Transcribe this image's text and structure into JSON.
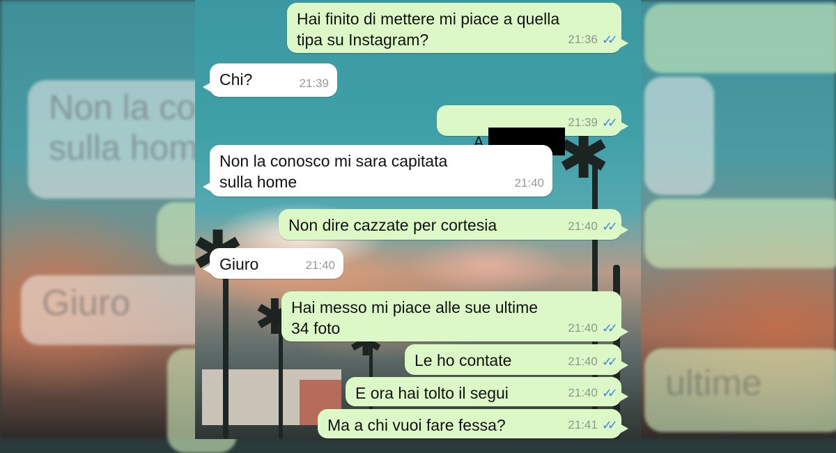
{
  "colors": {
    "outgoing_bubble": "#dcf8c6",
    "incoming_bubble": "#ffffff",
    "read_ticks": "#3d8be0"
  },
  "background_ghost_text": {
    "left_1": "Non la co",
    "left_2": "sulla hom",
    "left_3": "Giuro",
    "right_1": "ultime"
  },
  "messages": [
    {
      "direction": "out",
      "line1": "Hai finito di mettere mi piace a quella",
      "line2": "tipa su Instagram?",
      "time": "21:36",
      "ticks": "✓✓"
    },
    {
      "direction": "in",
      "line1": "Chi?",
      "time": "21:39"
    },
    {
      "direction": "out",
      "line1": "A",
      "redacted": true,
      "time": "21:39",
      "ticks": "✓✓"
    },
    {
      "direction": "in",
      "line1": "Non la conosco mi sara capitata",
      "line2": "sulla home",
      "time": "21:40"
    },
    {
      "direction": "out",
      "line1": "Non dire cazzate per cortesia",
      "time": "21:40",
      "ticks": "✓✓"
    },
    {
      "direction": "in",
      "line1": "Giuro",
      "time": "21:40"
    },
    {
      "direction": "out",
      "line1": "Hai messo mi piace alle sue ultime",
      "line2": "34 foto",
      "time": "21:40",
      "ticks": "✓✓"
    },
    {
      "direction": "out",
      "line1": "Le ho contate",
      "time": "21:40",
      "ticks": "✓✓"
    },
    {
      "direction": "out",
      "line1": "E ora hai tolto il segui",
      "time": "21:40",
      "ticks": "✓✓"
    },
    {
      "direction": "out",
      "line1": "Ma a chi vuoi fare fessa?",
      "time": "21:41",
      "ticks": "✓✓"
    }
  ]
}
